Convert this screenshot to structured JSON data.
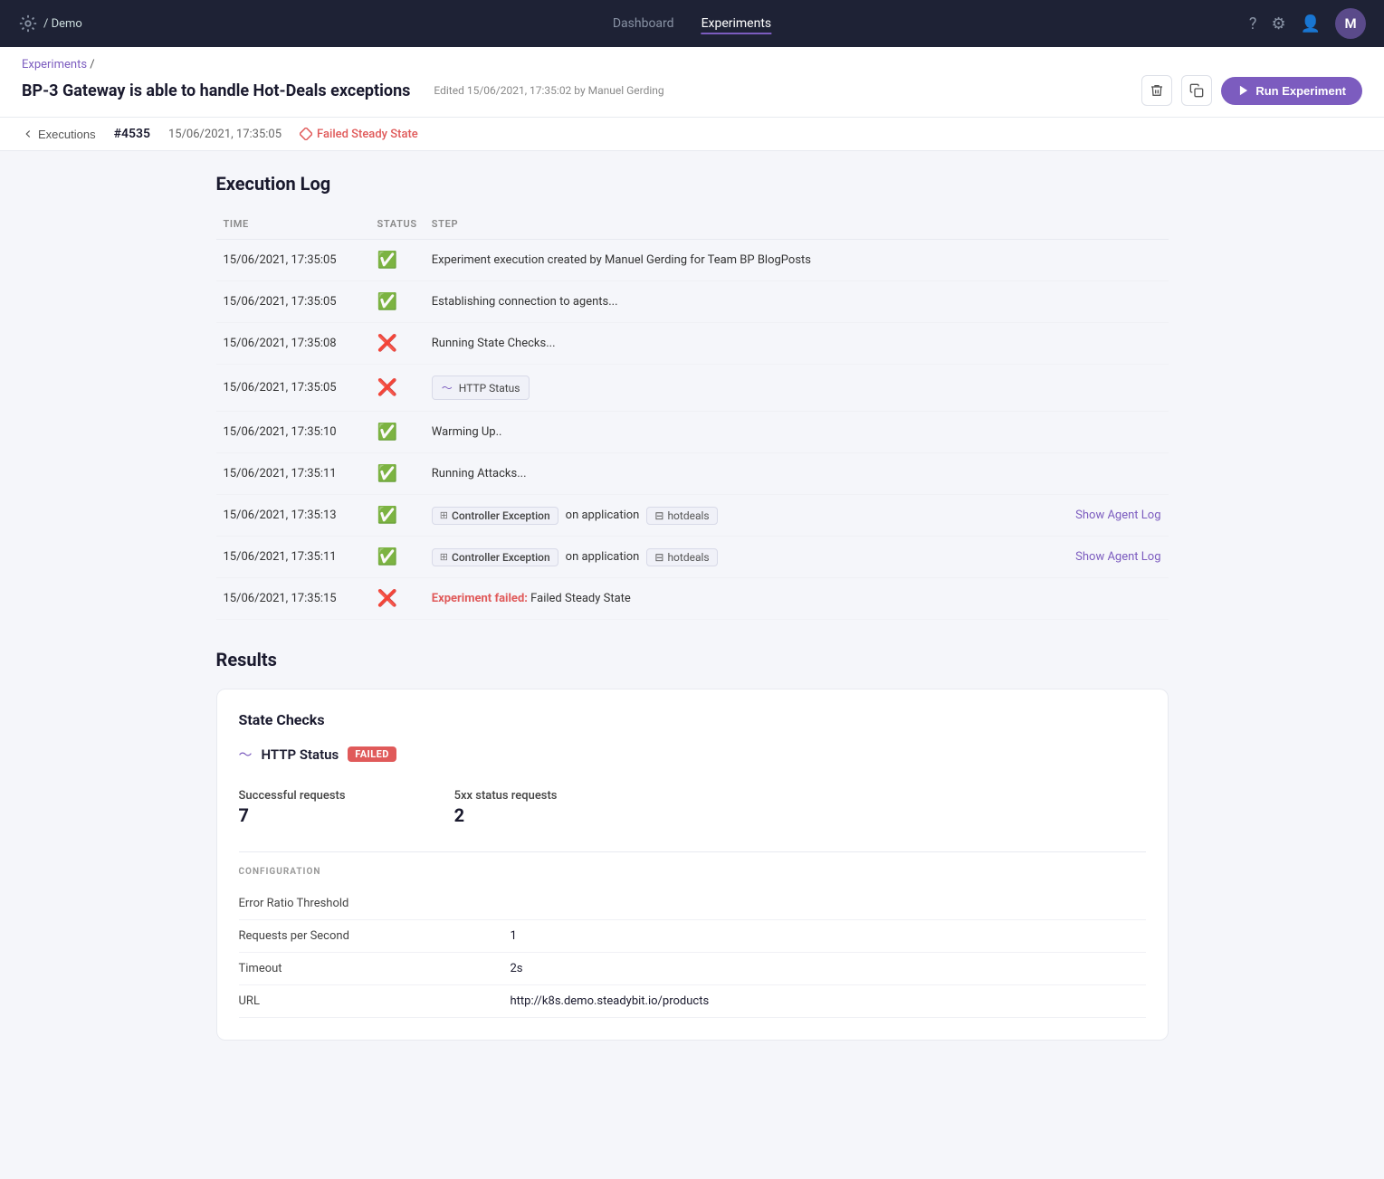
{
  "nav": {
    "logo_text": "/ Demo",
    "links": [
      {
        "label": "Dashboard",
        "active": false
      },
      {
        "label": "Experiments",
        "active": true
      }
    ]
  },
  "breadcrumb": {
    "parent": "Experiments",
    "separator": "/",
    "title": "BP-3 Gateway is able to handle Hot-Deals exceptions",
    "edited_by": "Edited 15/06/2021, 17:35:02 by Manuel Gerding"
  },
  "header_actions": {
    "run_label": "Run Experiment"
  },
  "execution_bar": {
    "back_label": "Executions",
    "id": "#4535",
    "time": "15/06/2021, 17:35:05",
    "status": "Failed Steady State"
  },
  "execution_log": {
    "title": "Execution Log",
    "columns": {
      "time": "TIME",
      "status": "STATUS",
      "step": "STEP"
    },
    "rows": [
      {
        "time": "15/06/2021, 17:35:05",
        "status": "success",
        "step_text": "Experiment execution created by Manuel Gerding for Team BP BlogPosts",
        "type": "text"
      },
      {
        "time": "15/06/2021, 17:35:05",
        "status": "success",
        "step_text": "Establishing connection to agents...",
        "type": "text"
      },
      {
        "time": "15/06/2021, 17:35:08",
        "status": "fail",
        "step_text": "Running State Checks...",
        "type": "text"
      },
      {
        "time": "15/06/2021, 17:35:05",
        "status": "fail",
        "step_text": "HTTP Status",
        "type": "http-status"
      },
      {
        "time": "15/06/2021, 17:35:10",
        "status": "success",
        "step_text": "Warming Up..",
        "type": "text"
      },
      {
        "time": "15/06/2021, 17:35:11",
        "status": "success",
        "step_text": "Running Attacks...",
        "type": "text"
      },
      {
        "time": "15/06/2021, 17:35:13",
        "status": "success",
        "step_tag": "Controller Exception",
        "step_mid": "on application",
        "step_app": "hotdeals",
        "agent_log": "Show Agent Log",
        "type": "attack"
      },
      {
        "time": "15/06/2021, 17:35:11",
        "status": "success",
        "step_tag": "Controller Exception",
        "step_mid": "on application",
        "step_app": "hotdeals",
        "agent_log": "Show Agent Log",
        "type": "attack"
      },
      {
        "time": "15/06/2021, 17:35:15",
        "status": "fail",
        "step_prefix": "Experiment failed:",
        "step_text": "Failed Steady State",
        "type": "failed"
      }
    ]
  },
  "results": {
    "title": "Results",
    "state_checks_title": "State Checks",
    "http_status_label": "HTTP Status",
    "failed_badge": "FAILED",
    "metrics": [
      {
        "label": "Successful requests",
        "value": "7"
      },
      {
        "label": "5xx status requests",
        "value": "2"
      }
    ],
    "config_label": "CONFIGURATION",
    "config_rows": [
      {
        "key": "Error Ratio Threshold",
        "value": ""
      },
      {
        "key": "Requests per Second",
        "value": "1"
      },
      {
        "key": "Timeout",
        "value": "2s"
      },
      {
        "key": "URL",
        "value": "http://k8s.demo.steadybit.io/products"
      }
    ]
  }
}
